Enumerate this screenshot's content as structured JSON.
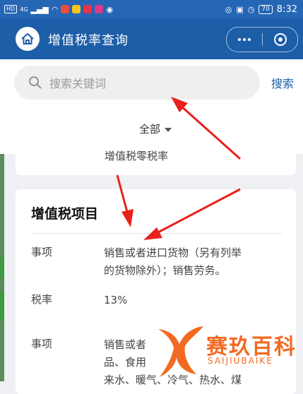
{
  "statusbar": {
    "left_chips": [
      "HD",
      "4G"
    ],
    "battery": "70",
    "time": "8:32"
  },
  "header": {
    "title": "增值税率查询",
    "home_icon": "home-icon",
    "more_icon": "more-dots-icon",
    "close_icon": "target-close-icon"
  },
  "search": {
    "placeholder": "搜索关键词",
    "button_label": "搜索"
  },
  "filter": {
    "selected": "全部"
  },
  "prev_card": {
    "partial_text": "增值税零税率"
  },
  "card": {
    "title": "增值税项目",
    "rows": [
      {
        "label": "事项",
        "lines": [
          "销售或者进口货物（另有列举",
          "的货物除外）；销售劳务。"
        ]
      },
      {
        "label": "税率",
        "lines": [
          "13%"
        ]
      },
      {
        "label": "事项",
        "lines": [
          "销售或者",
          "品、食用",
          "来水、暖气、冷气、热水、煤"
        ]
      }
    ]
  },
  "watermark": {
    "cn": "赛玖百科",
    "en": "SAIJIUBAIKE"
  },
  "colors": {
    "header_bg": "#1d5ea8",
    "statusbar_bg": "#2566b5",
    "accent": "#1d5ea8",
    "arrow": "#e8211b",
    "watermark": "#f26a22"
  }
}
